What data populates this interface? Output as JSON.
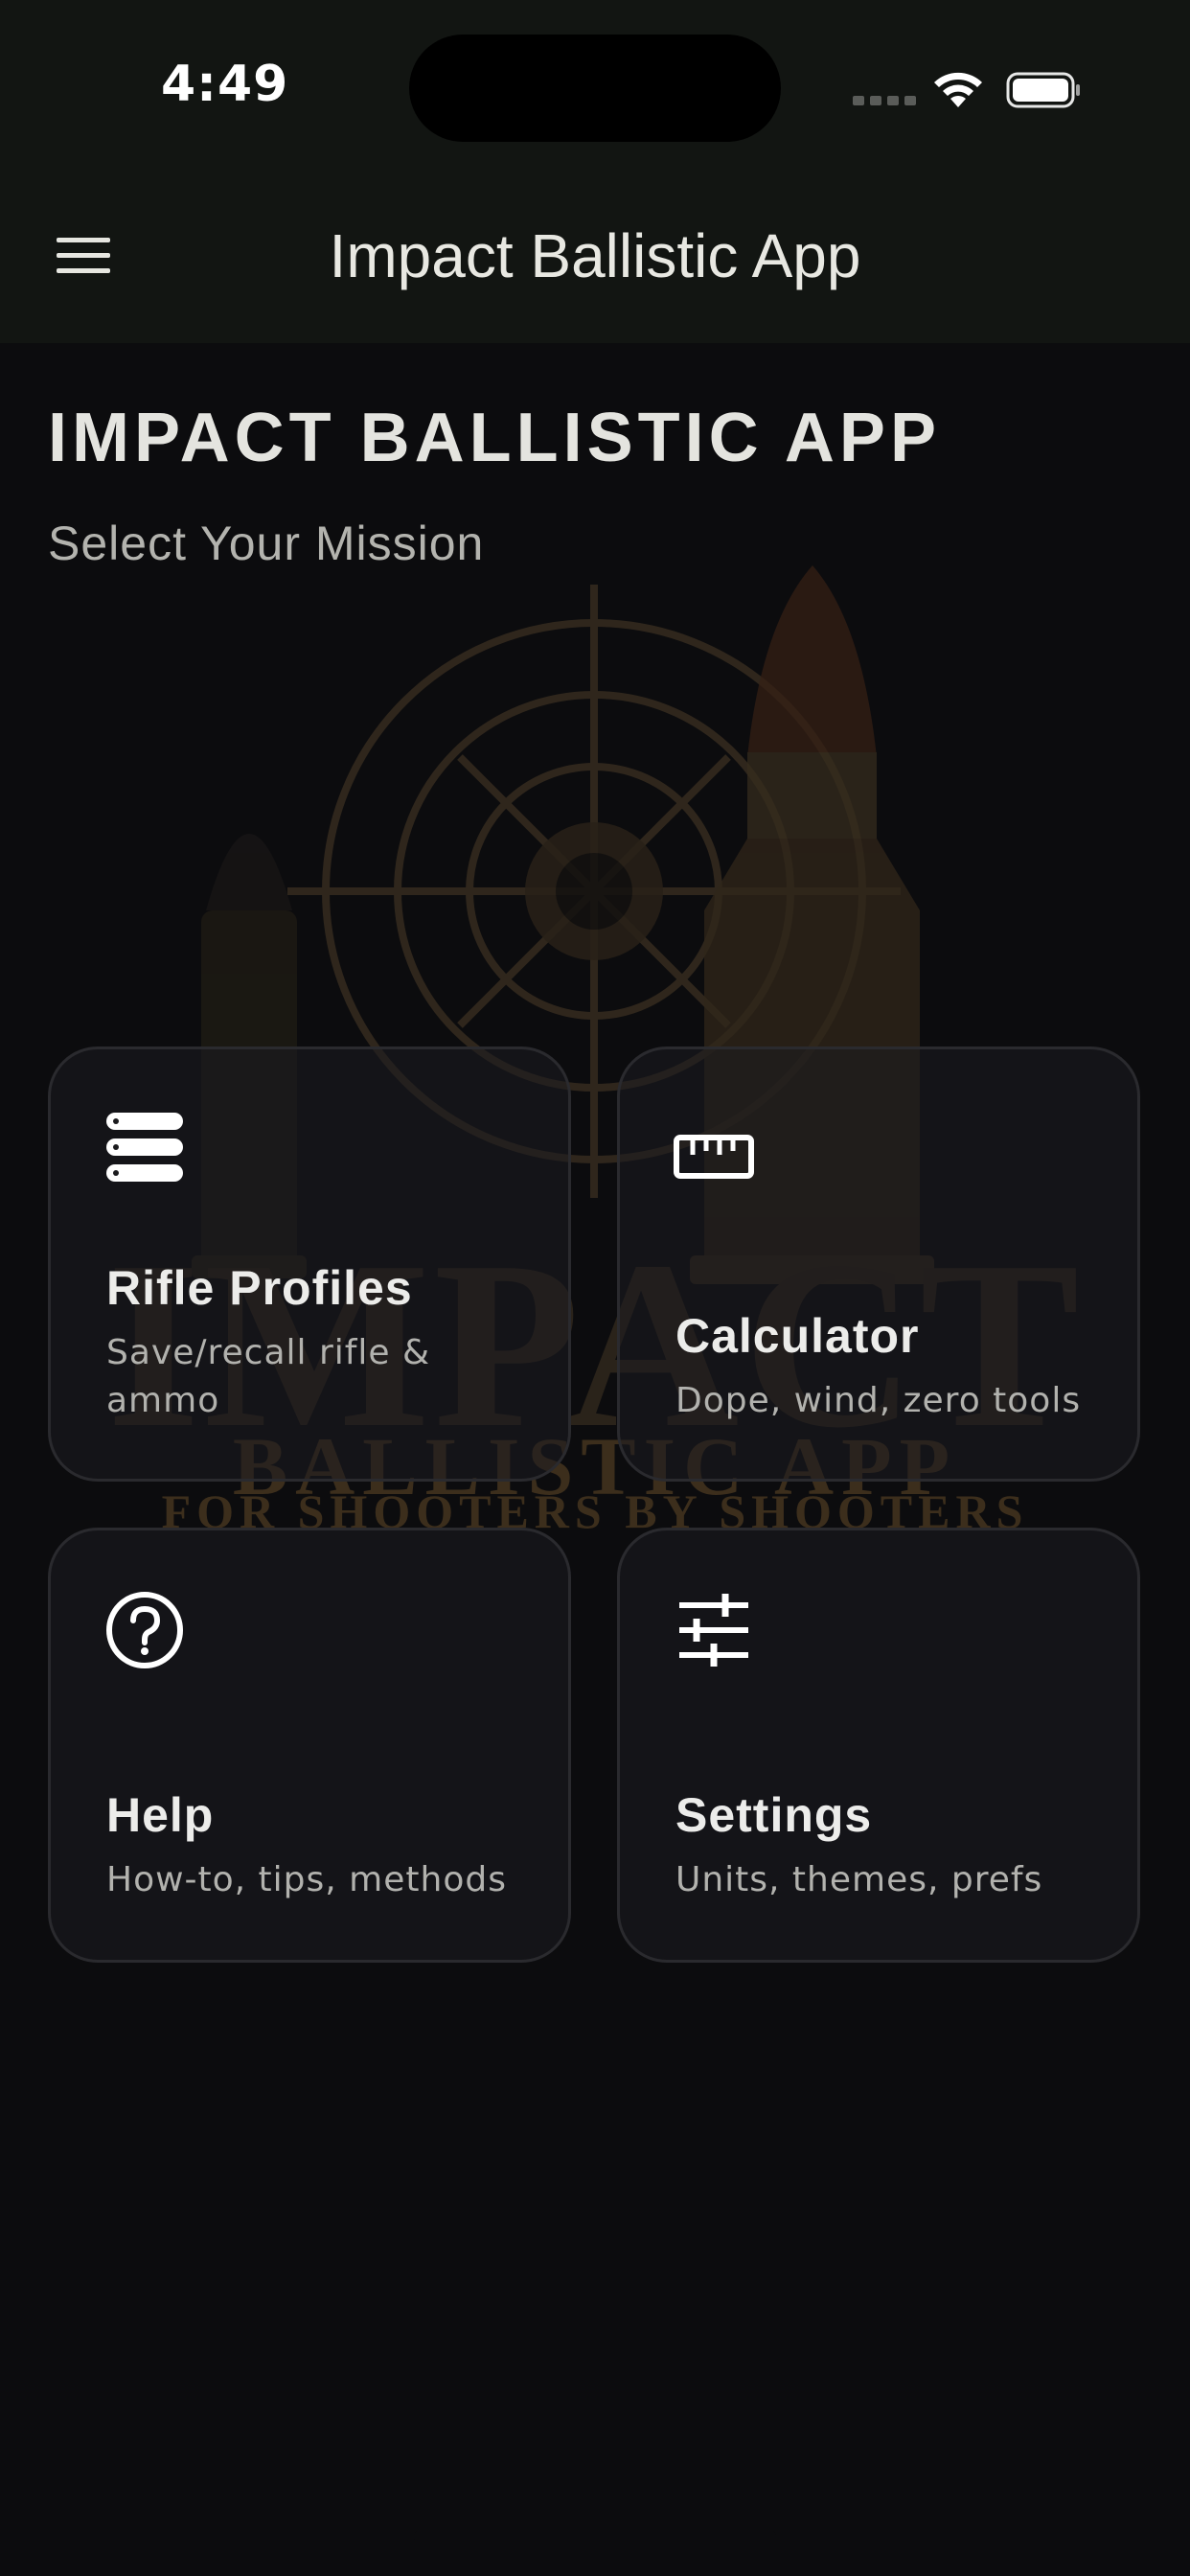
{
  "status_bar": {
    "time": "4:49",
    "wifi_icon": "wifi-icon",
    "battery_icon": "battery-icon"
  },
  "app_bar": {
    "menu_icon": "hamburger-menu-icon",
    "title": "Impact Ballistic App"
  },
  "main": {
    "title": "IMPACT BALLISTIC APP",
    "subtitle": "Select Your Mission"
  },
  "background_logo": {
    "word": "IMPACT",
    "line2": "BALLISTIC APP",
    "line3": "FOR SHOOTERS BY SHOOTERS"
  },
  "tiles": [
    {
      "icon": "stacked-list-icon",
      "title": "Rifle Profiles",
      "description": "Save/recall rifle & ammo"
    },
    {
      "icon": "ruler-icon",
      "title": "Calculator",
      "description": "Dope, wind, zero tools"
    },
    {
      "icon": "help-circle-icon",
      "title": "Help",
      "description": "How-to, tips, methods"
    },
    {
      "icon": "sliders-icon",
      "title": "Settings",
      "description": "Units, themes, prefs"
    }
  ],
  "colors": {
    "background": "#0c0c0e",
    "app_bar": "#121512",
    "tile_border": "#2a2a2e",
    "text_primary": "#ececea",
    "text_secondary": "#b2b2ae"
  }
}
